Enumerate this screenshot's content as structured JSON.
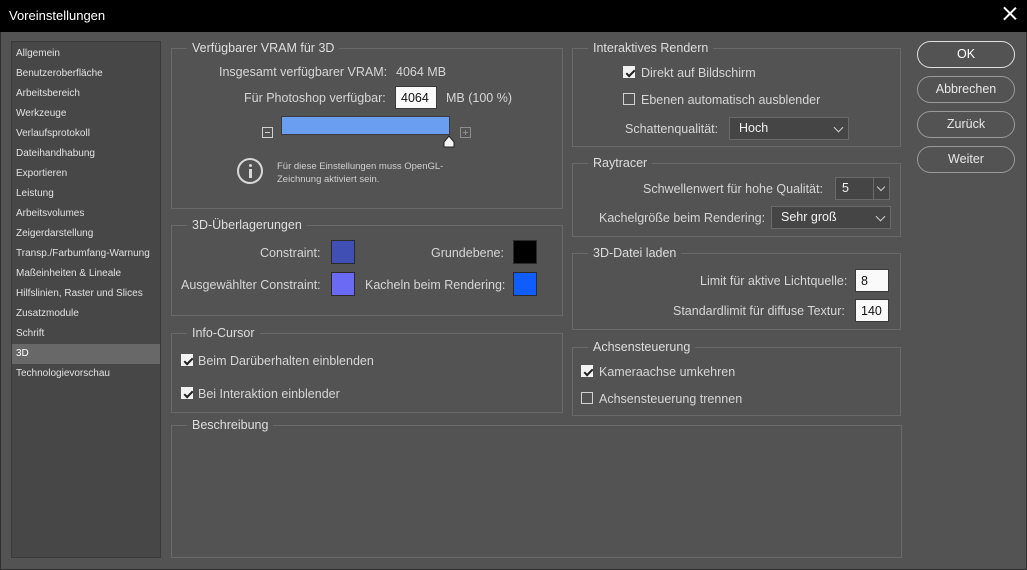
{
  "window": {
    "title": "Voreinstellungen"
  },
  "sidebar": {
    "items": [
      "Allgemein",
      "Benutzeroberfläche",
      "Arbeitsbereich",
      "Werkzeuge",
      "Verlaufsprotokoll",
      "Dateihandhabung",
      "Exportieren",
      "Leistung",
      "Arbeitsvolumes",
      "Zeigerdarstellung",
      "Transp./Farbumfang-Warnung",
      "Maßeinheiten & Lineale",
      "Hilfslinien, Raster und Slices",
      "Zusatzmodule",
      "Schrift",
      "3D",
      "Technologievorschau"
    ],
    "selected": "3D"
  },
  "vram": {
    "legend": "Verfügbarer VRAM für 3D",
    "total_label": "Insgesamt verfügbarer VRAM:",
    "total_value": "4064 MB",
    "ps_label": "Für Photoshop verfügbar:",
    "ps_value": "4064",
    "ps_unit": "MB (100 %)",
    "slider_percent": 100,
    "info_text": "Für diese Einstellungen muss OpenGL-Zeichnung aktiviert sein."
  },
  "overlays": {
    "legend": "3D-Überlagerungen",
    "constraint_label": "Constraint:",
    "groundplane_label": "Grundebene:",
    "selected_constraint_label": "Ausgewählter Constraint:",
    "tiles_label": "Kacheln beim Rendering:",
    "colors": {
      "constraint": "#3f4fb3",
      "groundplane": "#000000",
      "selected_constraint": "#6a6af5",
      "tiles": "#0f5cff"
    }
  },
  "info_cursor": {
    "legend": "Info-Cursor",
    "hover_label": "Beim Darüberhalten einblenden",
    "hover_checked": true,
    "interaction_label": "Bei Interaktion einblender",
    "interaction_checked": true
  },
  "description": {
    "legend": "Beschreibung"
  },
  "interactive": {
    "legend": "Interaktives Rendern",
    "direct_label": "Direkt auf Bildschirm",
    "direct_checked": true,
    "auto_hide_label": "Ebenen automatisch ausblender",
    "auto_hide_checked": false,
    "shadow_label": "Schattenqualität:",
    "shadow_value": "Hoch"
  },
  "raytracer": {
    "legend": "Raytracer",
    "threshold_label": "Schwellenwert für hohe Qualität:",
    "threshold_value": "5",
    "tile_label": "Kachelgröße beim Rendering:",
    "tile_value": "Sehr groß"
  },
  "file_load": {
    "legend": "3D-Datei laden",
    "light_label": "Limit für aktive Lichtquelle:",
    "light_value": "8",
    "texture_label": "Standardlimit für diffuse Textur:",
    "texture_value": "140"
  },
  "axis": {
    "legend": "Achsensteuerung",
    "invert_label": "Kameraachse umkehren",
    "invert_checked": true,
    "separate_label": "Achsensteuerung trennen",
    "separate_checked": false
  },
  "buttons": {
    "ok": "OK",
    "cancel": "Abbrechen",
    "back": "Zurück",
    "next": "Weiter"
  }
}
